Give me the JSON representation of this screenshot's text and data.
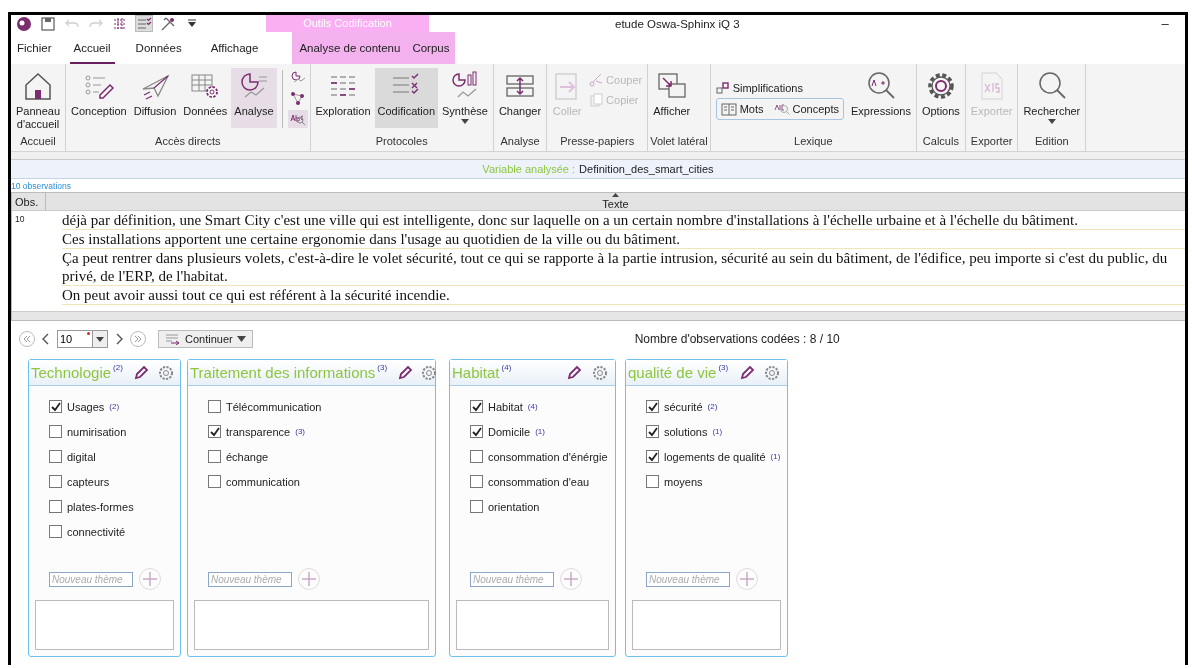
{
  "window": {
    "title": "etude Oswa-Sphinx iQ 3",
    "context_group": "Outils Codification",
    "minimize": "–"
  },
  "quick_access": [
    {
      "kind": "logo",
      "disabled": false,
      "selected": false
    },
    {
      "kind": "save",
      "disabled": false,
      "selected": false
    },
    {
      "kind": "undo",
      "disabled": true,
      "selected": false
    },
    {
      "kind": "redo",
      "disabled": true,
      "selected": false
    },
    {
      "kind": "grid",
      "disabled": false,
      "selected": false
    },
    {
      "kind": "checklist",
      "disabled": false,
      "selected": true
    },
    {
      "kind": "tools",
      "disabled": false,
      "selected": false
    },
    {
      "kind": "more",
      "disabled": false,
      "selected": false
    }
  ],
  "tabs": [
    {
      "label": "Fichier",
      "selected": false,
      "contextual": false
    },
    {
      "label": "Accueil",
      "selected": true,
      "contextual": false
    },
    {
      "label": "Données",
      "selected": false,
      "contextual": false
    },
    {
      "label": "Affichage",
      "selected": false,
      "contextual": false
    },
    {
      "label": "Analyse de contenu",
      "selected": false,
      "contextual": true
    },
    {
      "label": "Corpus",
      "selected": false,
      "contextual": true
    }
  ],
  "ribbon": {
    "groups": [
      {
        "label": "Accueil",
        "items": [
          {
            "kind": "large",
            "label": "Panneau\nd'accueil",
            "selected": false,
            "disabled": false,
            "dropdown": false
          }
        ]
      },
      {
        "label": "Accès directs",
        "items": [
          {
            "kind": "large",
            "label": "Conception",
            "selected": false,
            "disabled": false,
            "dropdown": false
          },
          {
            "kind": "large",
            "label": "Diffusion",
            "selected": false,
            "disabled": false,
            "dropdown": false
          },
          {
            "kind": "large",
            "label": "Données",
            "selected": false,
            "disabled": false,
            "dropdown": false
          },
          {
            "kind": "large",
            "label": "Analyse",
            "selected": true,
            "disabled": false,
            "dropdown": false
          },
          {
            "kind": "minis",
            "items": [
              {
                "selected": false
              },
              {
                "selected": false
              },
              {
                "selected": true
              }
            ]
          }
        ]
      },
      {
        "label": "Protocoles",
        "items": [
          {
            "kind": "large",
            "label": "Exploration",
            "selected": false,
            "disabled": false,
            "dropdown": false
          },
          {
            "kind": "large",
            "label": "Codification",
            "selected": true,
            "disabled": false,
            "dropdown": false
          },
          {
            "kind": "large",
            "label": "Synthèse",
            "selected": false,
            "disabled": false,
            "dropdown": true
          }
        ]
      },
      {
        "label": "Analyse",
        "items": [
          {
            "kind": "large",
            "label": "Changer",
            "selected": false,
            "disabled": false,
            "dropdown": false
          }
        ]
      },
      {
        "label": "Presse-papiers",
        "items": [
          {
            "kind": "large",
            "label": "Coller",
            "selected": false,
            "disabled": true,
            "dropdown": false
          },
          {
            "kind": "stack",
            "items": [
              {
                "kind": "small",
                "label": "Couper",
                "disabled": true
              },
              {
                "kind": "small",
                "label": "Copier",
                "disabled": true
              }
            ]
          }
        ]
      },
      {
        "label": "Volet latéral",
        "items": [
          {
            "kind": "large",
            "label": "Afficher",
            "selected": false,
            "disabled": false,
            "dropdown": false
          }
        ]
      },
      {
        "label": "Lexique",
        "items": [
          {
            "kind": "stack",
            "items": [
              {
                "kind": "small",
                "label": "Simplifications",
                "disabled": false
              },
              {
                "kind": "toggles",
                "items": [
                  {
                    "kind": "small",
                    "label": "Mots",
                    "disabled": false
                  },
                  {
                    "kind": "small",
                    "label": "Concepts",
                    "disabled": false
                  }
                ]
              }
            ]
          },
          {
            "kind": "large",
            "label": "Expressions",
            "selected": false,
            "disabled": false,
            "dropdown": false
          }
        ]
      },
      {
        "label": "Calculs",
        "items": [
          {
            "kind": "large",
            "label": "Options",
            "selected": false,
            "disabled": false,
            "dropdown": false
          }
        ]
      },
      {
        "label": "Exporter",
        "items": [
          {
            "kind": "large",
            "label": "Exporter",
            "selected": false,
            "disabled": true,
            "dropdown": false
          }
        ]
      },
      {
        "label": "Edition",
        "items": [
          {
            "kind": "large",
            "label": "Rechercher",
            "selected": false,
            "disabled": false,
            "dropdown": true
          }
        ]
      }
    ]
  },
  "variable_bar": {
    "label": "Variable analysée :",
    "value": "Definition_des_smart_cities"
  },
  "observations_count": "10 observations",
  "table": {
    "columns": [
      {
        "label": "Obs.",
        "sorted": false
      },
      {
        "label": "Texte",
        "sorted": true
      }
    ],
    "rows": [
      {
        "obs": "10",
        "paragraphs": [
          "déjà par définition, une Smart City c'est une ville qui est intelligente, donc sur laquelle on a un certain nombre d'installations à l'échelle urbaine et à l'échelle du bâtiment.",
          "Ces installations apportent une certaine ergonomie dans l'usage au quotidien de la ville ou du bâtiment.",
          "Ça peut rentrer dans plusieurs volets, c'est-à-dire le volet sécurité, tout ce qui se rapporte à la partie intrusion, sécurité au sein du bâtiment, de l'édifice, peu importe si c'est du public, du privé, de l'ERP, de l'habitat.",
          "On peut avoir aussi tout ce qui est référent à la sécurité incendie."
        ]
      }
    ]
  },
  "navigator": {
    "value": "10",
    "modified": true,
    "continue_label": "Continuer",
    "coded_count": "Nombre d'observations codées : 8 / 10"
  },
  "themes": [
    {
      "title": "Technologie",
      "count": "(2)",
      "placeholder": "Nouveau thème",
      "items": [
        {
          "label": "Usages",
          "count": "(2)",
          "checked": true
        },
        {
          "label": "numirisation",
          "checked": false
        },
        {
          "label": "digital",
          "checked": false
        },
        {
          "label": "capteurs",
          "checked": false
        },
        {
          "label": "plates-formes",
          "checked": false
        },
        {
          "label": "connectivité",
          "checked": false
        }
      ]
    },
    {
      "title": "Traitement des informations",
      "count": "(3)",
      "placeholder": "Nouveau thème",
      "items": [
        {
          "label": "Télécommunication",
          "checked": false
        },
        {
          "label": "transparence",
          "count": "(3)",
          "checked": true
        },
        {
          "label": "échange",
          "checked": false
        },
        {
          "label": "communication",
          "checked": false
        }
      ]
    },
    {
      "title": "Habitat",
      "count": "(4)",
      "placeholder": "Nouveau thème",
      "items": [
        {
          "label": "Habitat",
          "count": "(4)",
          "checked": true
        },
        {
          "label": "Domicile",
          "count": "(1)",
          "checked": true
        },
        {
          "label": "consommation d'énérgie",
          "checked": false
        },
        {
          "label": "consommation d'eau",
          "checked": false
        },
        {
          "label": "orientation",
          "checked": false
        }
      ]
    },
    {
      "title": "qualité de vie",
      "count": "(3)",
      "placeholder": "Nouveau thème",
      "items": [
        {
          "label": "sécurité",
          "count": "(2)",
          "checked": true
        },
        {
          "label": "solutions",
          "count": "(1)",
          "checked": true
        },
        {
          "label": "logements de qualité",
          "count": "(1)",
          "checked": true
        },
        {
          "label": "moyens",
          "checked": false
        }
      ]
    }
  ]
}
